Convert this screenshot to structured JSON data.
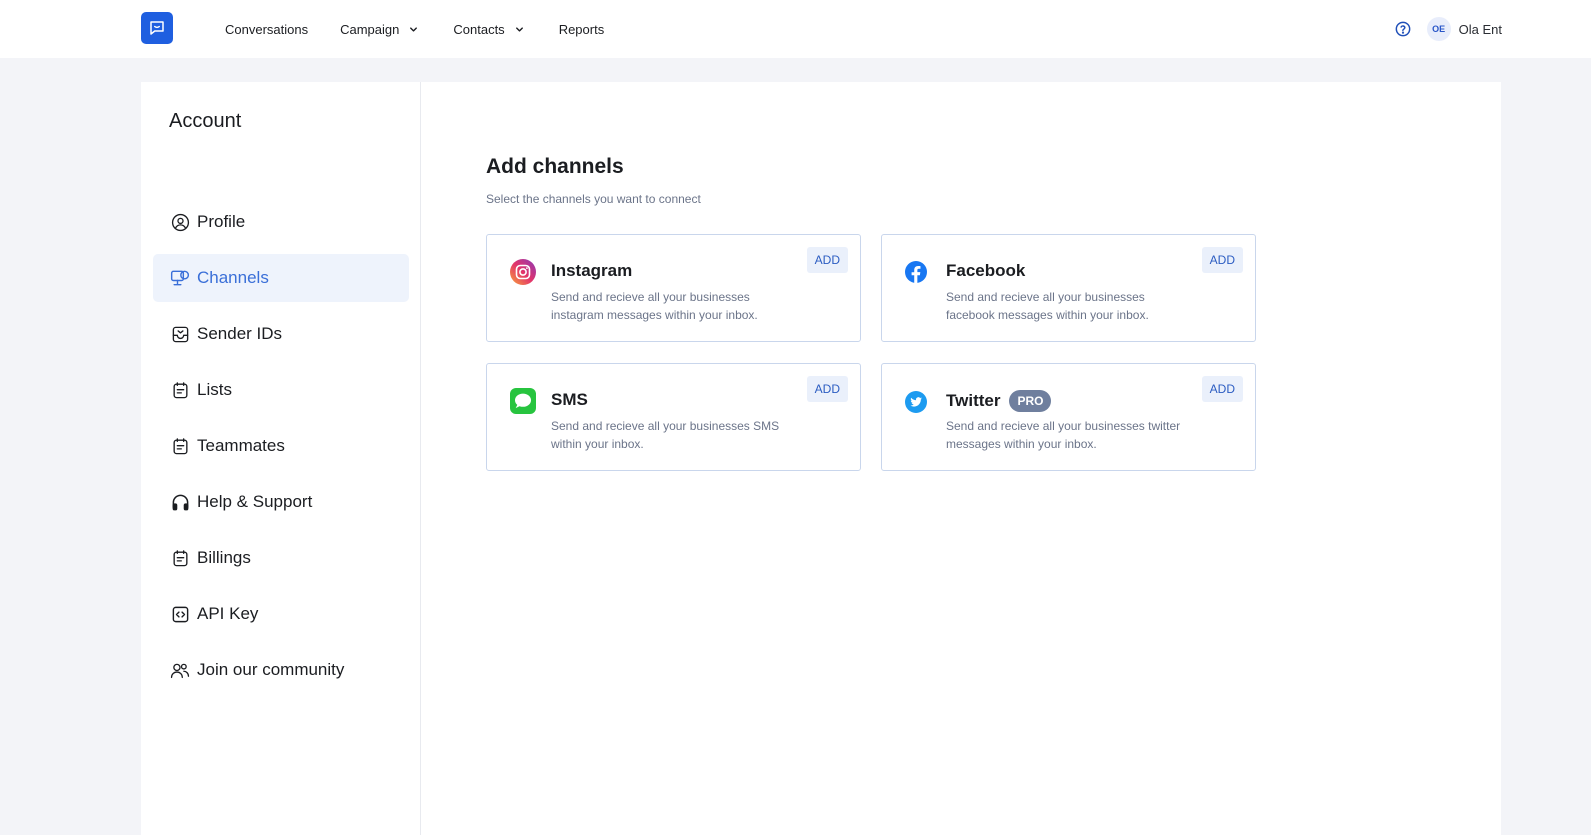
{
  "header": {
    "nav": {
      "conversations": "Conversations",
      "campaign": "Campaign",
      "contacts": "Contacts",
      "reports": "Reports"
    },
    "user": {
      "initials": "OE",
      "name": "Ola Ent"
    },
    "icons": {
      "logo": "chat-bubble-icon",
      "help": "question-circle-icon",
      "chevron": "chevron-down-icon"
    }
  },
  "sidebar": {
    "title": "Account",
    "items": [
      {
        "label": "Profile",
        "icon": "user-circle-icon"
      },
      {
        "label": "Channels",
        "icon": "channels-icon",
        "active": true
      },
      {
        "label": "Sender IDs",
        "icon": "inbox-icon"
      },
      {
        "label": "Lists",
        "icon": "list-icon"
      },
      {
        "label": "Teammates",
        "icon": "list-icon"
      },
      {
        "label": "Help & Support",
        "icon": "headphones-icon"
      },
      {
        "label": "Billings",
        "icon": "list-icon"
      },
      {
        "label": "API Key",
        "icon": "code-icon"
      },
      {
        "label": "Join our community",
        "icon": "users-icon"
      }
    ]
  },
  "main": {
    "title": "Add channels",
    "subtitle": "Select the channels you want to connect",
    "channels": [
      {
        "name": "Instagram",
        "description": "Send and recieve all your businesses instagram messages within your inbox.",
        "button": "ADD",
        "icon": "instagram-icon"
      },
      {
        "name": "Facebook",
        "description": "Send and recieve all your businesses facebook messages within your inbox.",
        "button": "ADD",
        "icon": "facebook-icon"
      },
      {
        "name": "SMS",
        "description": "Send and recieve all your businesses SMS within your inbox.",
        "button": "ADD",
        "icon": "sms-icon"
      },
      {
        "name": "Twitter",
        "badge": "PRO",
        "description": "Send and recieve all your businesses twitter messages within your inbox.",
        "button": "ADD",
        "icon": "twitter-icon"
      }
    ]
  },
  "colors": {
    "brand": "#1f5fe0",
    "active_bg": "#eef3fc",
    "active_text": "#3a6fd8",
    "page_bg": "#f3f4f8",
    "badge": "#6f7f9e"
  }
}
